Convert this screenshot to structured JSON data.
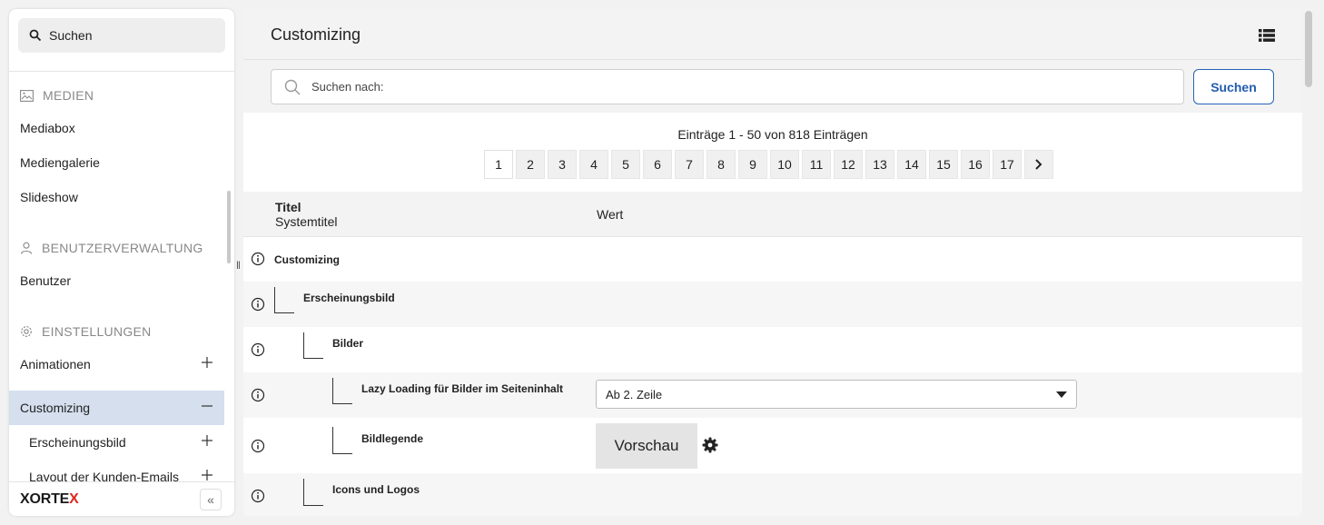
{
  "sidebar": {
    "search_label": "Suchen",
    "sections": {
      "medien": "MEDIEN",
      "benutzerverwaltung": "BENUTZERVERWALTUNG",
      "einstellungen": "EINSTELLUNGEN"
    },
    "items": {
      "mediabox": "Mediabox",
      "mediengalerie": "Mediengalerie",
      "slideshow": "Slideshow",
      "benutzer": "Benutzer",
      "animationen": "Animationen",
      "customizing": "Customizing",
      "erscheinungsbild": "Erscheinungsbild",
      "layout_kunden_emails": "Layout der Kunden-Emails"
    },
    "logo": {
      "part1": "X",
      "part2": "ORTE",
      "part3": "X"
    },
    "collapse_glyph": "«",
    "resize_glyph": "‖"
  },
  "header": {
    "title": "Customizing"
  },
  "search": {
    "placeholder": "Suchen nach:",
    "button_label": "Suchen"
  },
  "pagination": {
    "summary": "Einträge 1 - 50 von 818 Einträgen",
    "pages": [
      "1",
      "2",
      "3",
      "4",
      "5",
      "6",
      "7",
      "8",
      "9",
      "10",
      "11",
      "12",
      "13",
      "14",
      "15",
      "16",
      "17"
    ],
    "current": "1",
    "next_glyph": "›"
  },
  "table": {
    "col_title": "Titel",
    "col_systemtitle": "Systemtitel",
    "col_value": "Wert",
    "rows": {
      "customizing": "Customizing",
      "erscheinungsbild": "Erscheinungsbild",
      "bilder": "Bilder",
      "lazy_loading": "Lazy Loading für Bilder im Seiteninhalt",
      "lazy_loading_value": "Ab 2. Zeile",
      "bildlegende": "Bildlegende",
      "bildlegende_button": "Vorschau",
      "icons_logos": "Icons und Logos"
    }
  },
  "colors": {
    "accent": "#1f5cb0",
    "active_nav": "#d5dfee",
    "logo_red": "#e2261d"
  }
}
